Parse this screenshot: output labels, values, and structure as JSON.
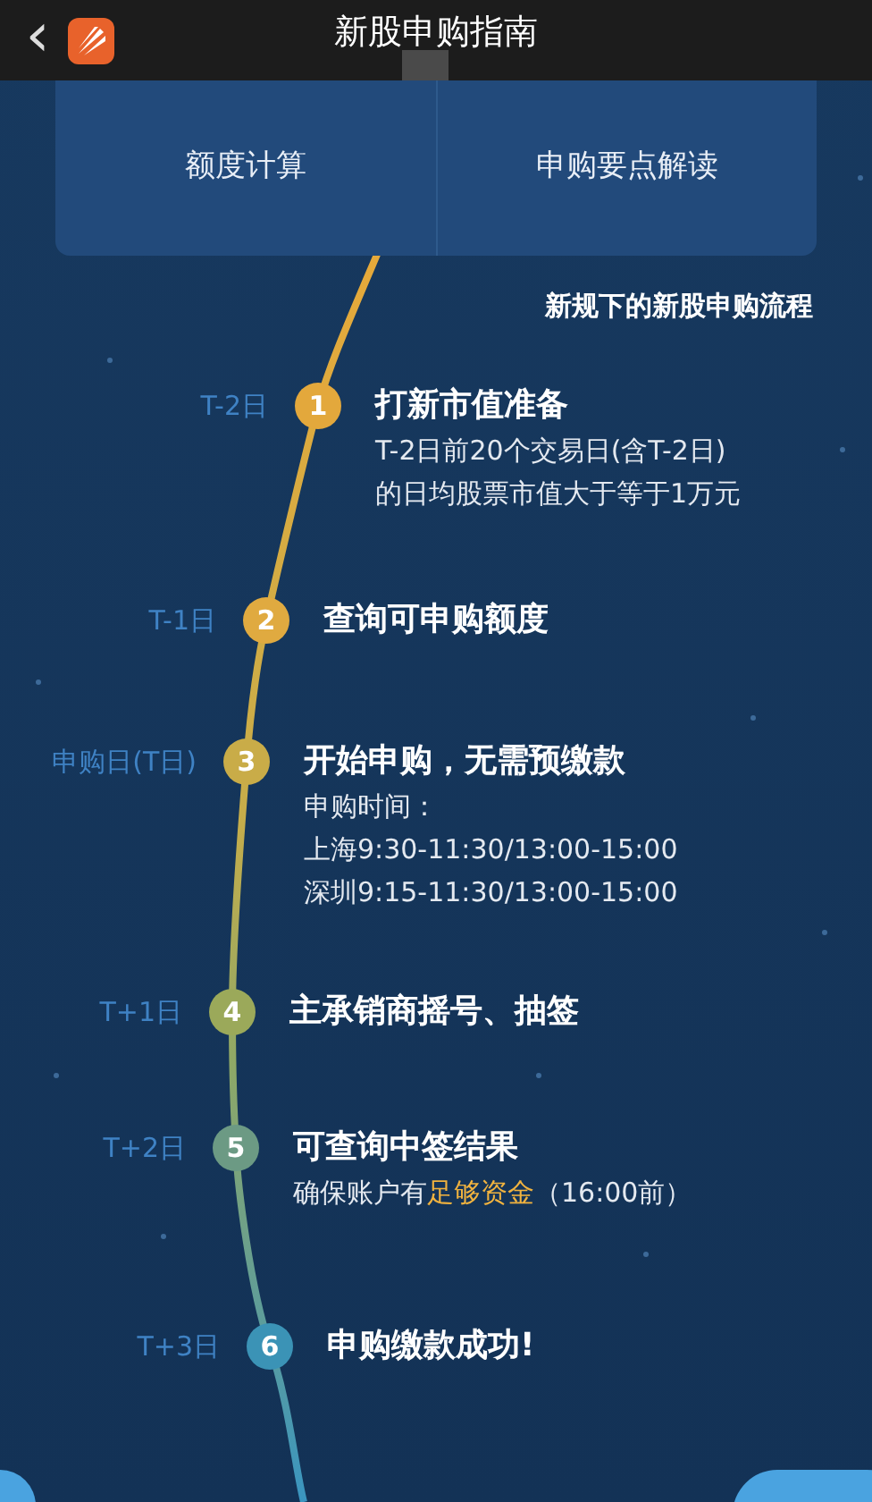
{
  "header": {
    "title": "新股申购指南",
    "back": "‹"
  },
  "tabs": [
    {
      "label": "额度计算"
    },
    {
      "label": "申购要点解读"
    }
  ],
  "flow_title": "新规下的新股申购流程",
  "steps": [
    {
      "day": "T-2日",
      "number": "1",
      "color": "#e3a83c",
      "title": "打新市值准备",
      "details": [
        "T-2日前20个交易日(含T-2日)",
        "的日均股票市值大于等于1万元"
      ]
    },
    {
      "day": "T-1日",
      "number": "2",
      "color": "#e0aa40",
      "title": "查询可申购额度"
    },
    {
      "day": "申购日(T日)",
      "number": "3",
      "color": "#c9ac48",
      "title": "开始申购，无需预缴款",
      "details": [
        "申购时间：",
        "上海9:30-11:30/13:00-15:00",
        "深圳9:15-11:30/13:00-15:00"
      ]
    },
    {
      "day": "T+1日",
      "number": "4",
      "color": "#9ba95a",
      "title": "主承销商摇号、抽签"
    },
    {
      "day": "T+2日",
      "number": "5",
      "color": "#6c9a84",
      "title": "可查询中签结果",
      "details": [
        "确保账户有**足够资金**（16:00前）"
      ]
    },
    {
      "day": "T+3日",
      "number": "6",
      "color": "#3b93b6",
      "title": "申购缴款成功!"
    }
  ]
}
